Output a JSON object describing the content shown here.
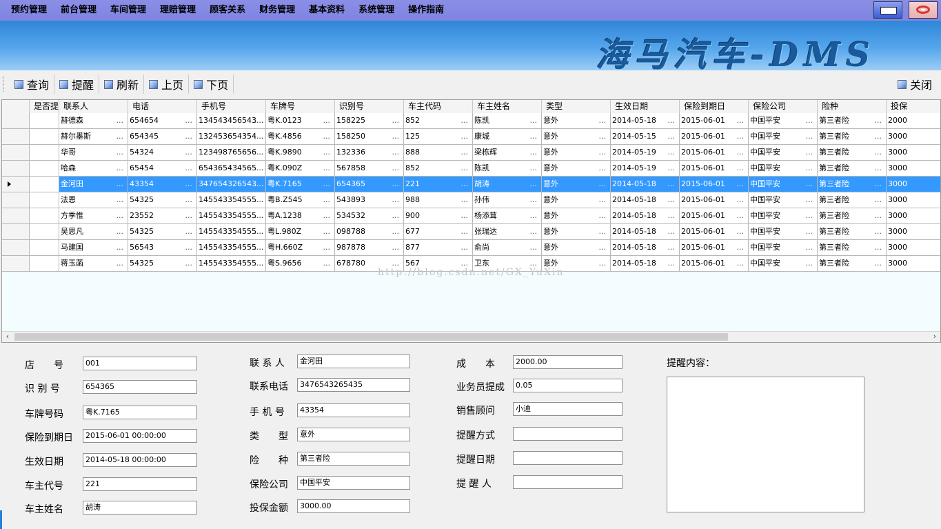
{
  "menu": [
    "预约管理",
    "前台管理",
    "车间管理",
    "理赔管理",
    "顾客关系",
    "财务管理",
    "基本资料",
    "系统管理",
    "操作指南"
  ],
  "banner_title": "海马汽车-DMS",
  "toolbar": {
    "query": "查询",
    "remind": "提醒",
    "refresh": "刷新",
    "prev": "上页",
    "next": "下页",
    "close": "关闭"
  },
  "grid": {
    "columns": [
      "是否提醒",
      "联系人",
      "电话",
      "手机号",
      "车牌号",
      "识别号",
      "车主代码",
      "车主姓名",
      "类型",
      "生效日期",
      "保险到期日",
      "保险公司",
      "险种",
      "投保"
    ],
    "rows": [
      [
        "",
        "赫德森",
        "654654",
        "134543456543...",
        "粤K.0123",
        "158225",
        "852",
        "陈凯",
        "意外",
        "2014-05-18",
        "2015-06-01",
        "中国平安",
        "第三者险",
        "2000"
      ],
      [
        "",
        "赫尔墨斯",
        "654345",
        "132453654354...",
        "粤K.4856",
        "158250",
        "125",
        "康城",
        "意外",
        "2014-05-15",
        "2015-06-01",
        "中国平安",
        "第三者险",
        "3000"
      ],
      [
        "",
        "华哥",
        "54324",
        "123498765656...",
        "粤K.9890",
        "132336",
        "888",
        "梁栋辉",
        "意外",
        "2014-05-19",
        "2015-06-01",
        "中国平安",
        "第三者险",
        "3000"
      ],
      [
        "",
        "哈森",
        "65454",
        "654365434565...",
        "粤K.090Z",
        "567858",
        "852",
        "陈凯",
        "意外",
        "2014-05-19",
        "2015-06-01",
        "中国平安",
        "第三者险",
        "3000"
      ],
      [
        "",
        "金河田",
        "43354",
        "347654326543...",
        "粤K.7165",
        "654365",
        "221",
        "胡涛",
        "意外",
        "2014-05-18",
        "2015-06-01",
        "中国平安",
        "第三者险",
        "3000"
      ],
      [
        "",
        "法恩",
        "54325",
        "145543354555...",
        "粤B.Z545",
        "543893",
        "988",
        "孙伟",
        "意外",
        "2014-05-18",
        "2015-06-01",
        "中国平安",
        "第三者险",
        "3000"
      ],
      [
        "",
        "方季惟",
        "23552",
        "145543354555...",
        "粤A.1238",
        "534532",
        "900",
        "杨添茸",
        "意外",
        "2014-05-18",
        "2015-06-01",
        "中国平安",
        "第三者险",
        "3000"
      ],
      [
        "",
        "吴思凡",
        "54325",
        "145543354555...",
        "粤L.980Z",
        "098788",
        "677",
        "张瑞达",
        "意外",
        "2014-05-18",
        "2015-06-01",
        "中国平安",
        "第三者险",
        "3000"
      ],
      [
        "",
        "马建国",
        "56543",
        "145543354555...",
        "粤H.660Z",
        "987878",
        "877",
        "俞尚",
        "意外",
        "2014-05-18",
        "2015-06-01",
        "中国平安",
        "第三者险",
        "3000"
      ],
      [
        "",
        "蒋玉菡",
        "54325",
        "145543354555...",
        "粤S.9656",
        "678780",
        "567",
        "卫东",
        "意外",
        "2014-05-18",
        "2015-06-01",
        "中国平安",
        "第三者险",
        "3000"
      ]
    ],
    "selected_row": 4,
    "watermark": "http://blog.csdn.net/GX_YuXin"
  },
  "form": {
    "col1": [
      {
        "label": "店　　号",
        "value": "001"
      },
      {
        "label": "识 别 号",
        "value": "654365"
      },
      {
        "label": "车牌号码",
        "value": "粤K.7165"
      },
      {
        "label": "保险到期日",
        "value": "2015-06-01 00:00:00"
      },
      {
        "label": "生效日期",
        "value": "2014-05-18 00:00:00"
      },
      {
        "label": "车主代号",
        "value": "221"
      },
      {
        "label": "车主姓名",
        "value": "胡涛"
      }
    ],
    "col2": [
      {
        "label": "联 系 人",
        "value": "金河田"
      },
      {
        "label": "联系电话",
        "value": "3476543265435"
      },
      {
        "label": "手 机 号",
        "value": "43354"
      },
      {
        "label": "类　　型",
        "value": "意外"
      },
      {
        "label": "险　　种",
        "value": "第三者险"
      },
      {
        "label": "保险公司",
        "value": "中国平安"
      },
      {
        "label": "投保金额",
        "value": "3000.00"
      }
    ],
    "col3": [
      {
        "label": "成　　本",
        "value": "2000.00"
      },
      {
        "label": "业务员提成",
        "value": "0.05"
      },
      {
        "label": "销售顾问",
        "value": "小迪"
      },
      {
        "label": "提醒方式",
        "value": ""
      },
      {
        "label": "提醒日期",
        "value": ""
      },
      {
        "label": "提 醒 人",
        "value": ""
      }
    ],
    "memo_label": "提醒内容："
  },
  "colors": {
    "menubar": "#8a8ee6",
    "selected": "#3399ff",
    "grid_bg": "#f3fdff"
  }
}
